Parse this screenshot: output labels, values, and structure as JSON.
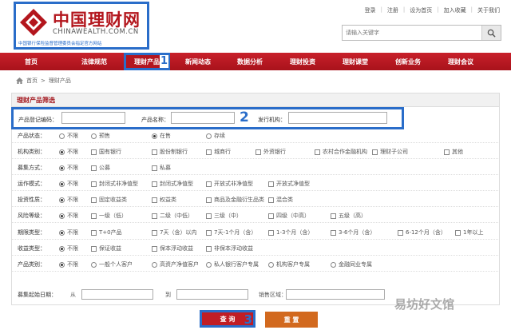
{
  "header": {
    "logo_cn": "中国理财网",
    "logo_en": "CHINAWEALTH.COM.CN",
    "logo_sub": "中国银行保险监督管理委员会指定官方网站",
    "toplinks": [
      "登录",
      "注册",
      "设为首页",
      "加入收藏",
      "关于我们"
    ],
    "search_placeholder": "请输入关键字"
  },
  "nav": {
    "items": [
      "首页",
      "法律规范",
      "理财产品",
      "新闻动态",
      "数据分析",
      "理财投资",
      "理财课堂",
      "创新业务",
      "理财会议"
    ],
    "active_index": 2,
    "marker": "1"
  },
  "breadcrumb": {
    "home": "首页",
    "current": "理财产品"
  },
  "panel": {
    "title": "理财产品筛选",
    "fields": {
      "reg_code": "产品登记编码：",
      "name": "产品名称：",
      "issuer": "发行机构：",
      "marker": "2"
    },
    "rows": [
      {
        "label": "产品状态：",
        "type": "radio",
        "options": [
          "不限",
          "预售",
          "在售",
          "存续"
        ],
        "checked": 2
      },
      {
        "label": "机构类别：",
        "type": "mixed",
        "options": [
          "不限",
          "国有银行",
          "股份制银行",
          "城商行",
          "外资银行",
          "农村合作金融机构",
          "理财子公司",
          "其他"
        ],
        "checked": 0
      },
      {
        "label": "募集方式：",
        "type": "mixed",
        "options": [
          "不限",
          "公募",
          "私募"
        ],
        "checked": 0
      },
      {
        "label": "运作模式：",
        "type": "mixed",
        "options": [
          "不限",
          "封闭式非净值型",
          "封闭式净值型",
          "开放式非净值型",
          "开放式净值型"
        ],
        "checked": 0
      },
      {
        "label": "投资性质：",
        "type": "mixed",
        "options": [
          "不限",
          "固定收益类",
          "权益类",
          "商品及金融衍生品类",
          "混合类"
        ],
        "checked": 0
      },
      {
        "label": "风险等级：",
        "type": "mixed",
        "options": [
          "不限",
          "一级（低）",
          "二级（中低）",
          "三级（中）",
          "四级（中高）",
          "五级（高）"
        ],
        "checked": 0
      },
      {
        "label": "期限类型：",
        "type": "mixed",
        "options": [
          "不限",
          "T+0产品",
          "7天（含）以内",
          "7天-1个月（含）",
          "1-3个月（含）",
          "3-6个月（含）",
          "6-12个月（含）",
          "1年以上"
        ],
        "checked": 0
      },
      {
        "label": "收益类型：",
        "type": "mixed",
        "options": [
          "不限",
          "保证收益",
          "保本浮动收益",
          "非保本浮动收益"
        ],
        "checked": 0
      },
      {
        "label": "产品类别：",
        "type": "radio",
        "options": [
          "不限",
          "一般个人客户",
          "高资产净值客户",
          "私人银行客户专属",
          "机构客户专属",
          "金融同业专属"
        ],
        "checked": 0
      }
    ],
    "date_row": {
      "label": "募集起始日期：",
      "from": "从",
      "to": "到",
      "region": "销售区域："
    }
  },
  "buttons": {
    "query": "查 询",
    "query_marker": "3",
    "reset": "重 置"
  },
  "watermark": "易坊好文馆"
}
